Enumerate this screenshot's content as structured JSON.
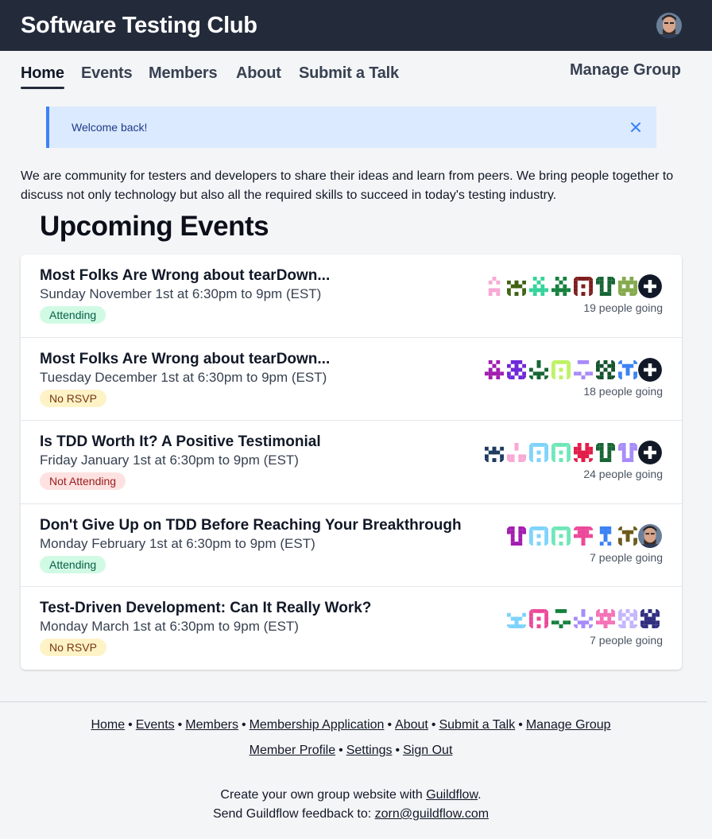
{
  "header": {
    "title": "Software Testing Club"
  },
  "nav": {
    "items": [
      {
        "label": "Home",
        "active": true
      },
      {
        "label": "Events"
      },
      {
        "label": "Members"
      },
      {
        "label": "About"
      },
      {
        "label": "Submit a Talk"
      }
    ],
    "manage_label": "Manage Group"
  },
  "alert": {
    "text": "Welcome back!"
  },
  "intro": "We are community for testers and developers to share their ideas and learn from peers. We bring people together to discuss not only technology but also all the required skills to succeed in today's testing industry.",
  "section_title": "Upcoming Events",
  "events": [
    {
      "title": "Most Folks Are Wrong about tearDown...",
      "date": "Sunday November 1st at 6:30pm to 9pm (EST)",
      "status": "Attending",
      "going": "19 people going",
      "avatar_colors": [
        "#f9a8d4",
        "#3f6212",
        "#34d399",
        "#15803d",
        "#7f1d1d",
        "#166534",
        "#84a94c"
      ],
      "has_more": true
    },
    {
      "title": "Most Folks Are Wrong about tearDown...",
      "date": "Tuesday December 1st at 6:30pm to 9pm (EST)",
      "status": "No RSVP",
      "going": "18 people going",
      "avatar_colors": [
        "#a21caf",
        "#6d28d9",
        "#166534",
        "#bef264",
        "#a78bfa",
        "#14532d",
        "#3b82f6"
      ],
      "has_more": true
    },
    {
      "title": "Is TDD Worth It? A Positive Testimonial",
      "date": "Friday January 1st at 6:30pm to 9pm (EST)",
      "status": "Not Attending",
      "going": "24 people going",
      "avatar_colors": [
        "#1e3a5f",
        "#f9a8d4",
        "#7dd3fc",
        "#6ee7b7",
        "#e11d48",
        "#166534",
        "#a78bfa"
      ],
      "has_more": true
    },
    {
      "title": "Don't Give Up on TDD Before Reaching Your Breakthrough",
      "date": "Monday February 1st at 6:30pm to 9pm (EST)",
      "status": "Attending",
      "going": "7 people going",
      "avatar_colors": [
        "#a21caf",
        "#7dd3fc",
        "#6ee7b7",
        "#ec4899",
        "#3b82f6",
        "#6b5a1a"
      ],
      "has_photo": true
    },
    {
      "title": "Test-Driven Development: Can It Really Work?",
      "date": "Monday March 1st at 6:30pm to 9pm (EST)",
      "status": "No RSVP",
      "going": "7 people going",
      "avatar_colors": [
        "#7dd3fc",
        "#ec4899",
        "#15803d",
        "#a78bfa",
        "#f472b6",
        "#c4b5fd",
        "#312e81"
      ]
    }
  ],
  "footer": {
    "row1": [
      "Home",
      "Events",
      "Members",
      "Membership Application",
      "About",
      "Submit a Talk",
      "Manage Group"
    ],
    "row2": [
      "Member Profile",
      "Settings",
      "Sign Out"
    ],
    "create_prefix": "Create your own group website with ",
    "create_link": "Guildflow",
    "create_suffix": ".",
    "feedback_prefix": "Send Guildflow feedback to: ",
    "feedback_link": "zorn@guildflow.com"
  }
}
